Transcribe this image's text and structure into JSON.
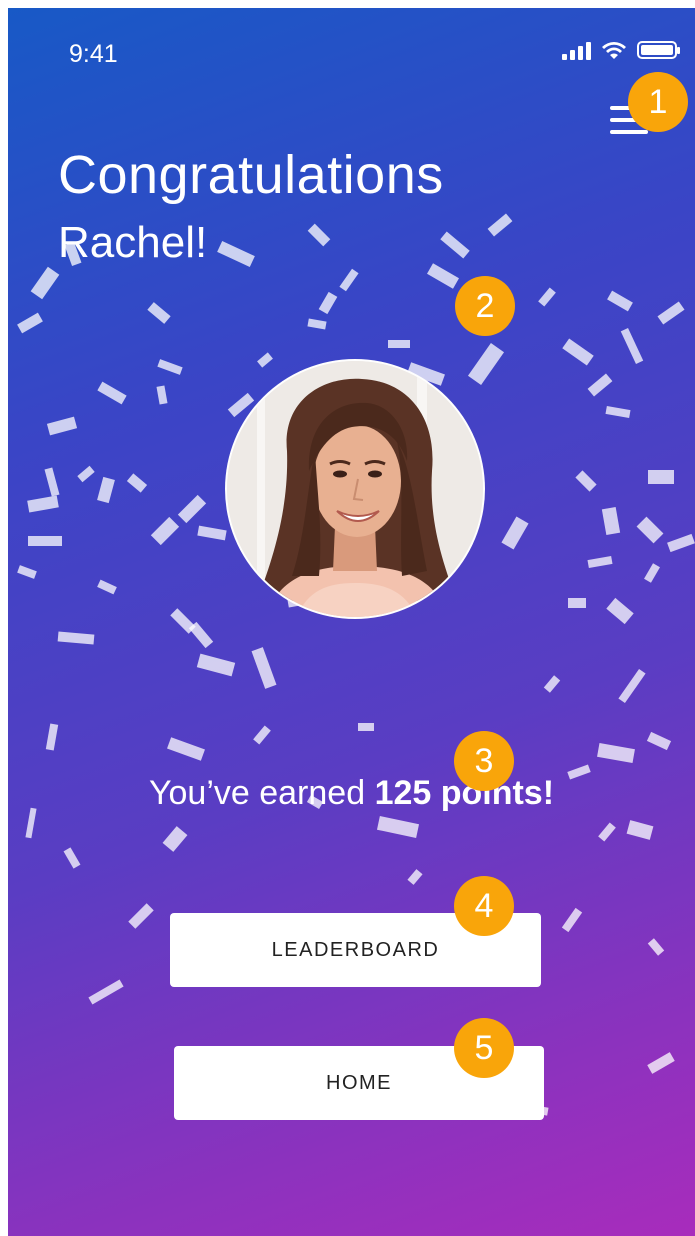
{
  "status_bar": {
    "time": "9:41"
  },
  "header": {
    "title": "Congratulations",
    "subtitle": "Rachel!",
    "menu_icon": "hamburger-menu-icon"
  },
  "reward": {
    "prefix": "You’ve earned ",
    "points_text": "125 points!"
  },
  "buttons": {
    "leaderboard": "LEADERBOARD",
    "home": "HOME"
  },
  "annotations": [
    "1",
    "2",
    "3",
    "4",
    "5"
  ],
  "colors": {
    "gradient_top": "#1859c6",
    "gradient_bottom": "#a82cbc",
    "badge": "#f9a50a",
    "button_bg": "#ffffff",
    "button_text": "#222222"
  }
}
